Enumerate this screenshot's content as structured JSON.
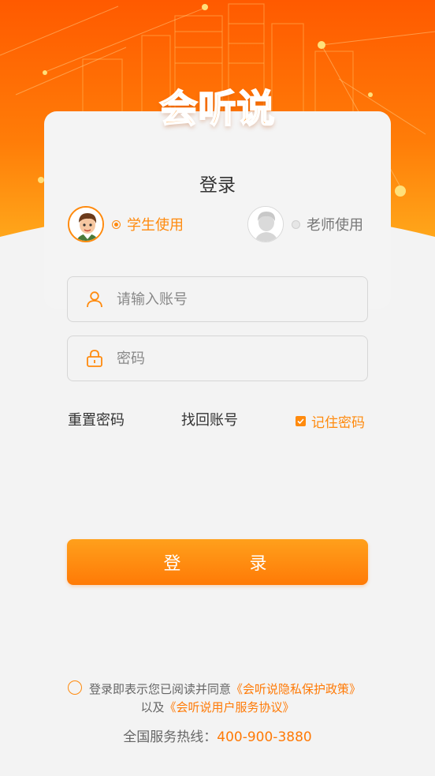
{
  "app": {
    "logo_text": "会听说"
  },
  "colors": {
    "brand": "#ff8a0d",
    "hero_gradient_start": "#ff5a00",
    "hero_gradient_end": "#ffa61a",
    "background": "#f3f3f3",
    "text": "#333333"
  },
  "login": {
    "title": "登录",
    "roles": [
      {
        "label": "学生使用",
        "selected": true,
        "icon": "student-avatar-icon"
      },
      {
        "label": "老师使用",
        "selected": false,
        "icon": "teacher-avatar-icon"
      }
    ],
    "account": {
      "placeholder": "请输入账号",
      "value": "",
      "icon": "user-icon"
    },
    "password": {
      "placeholder": "密码",
      "value": "",
      "icon": "lock-icon"
    },
    "reset_password": "重置密码",
    "recover_account": "找回账号",
    "remember_password": {
      "label": "记住密码",
      "checked": true
    },
    "submit_label": "登 录"
  },
  "footer": {
    "agreement_prefix": "登录即表示您已阅读并同意",
    "privacy_policy": "《会听说隐私保护政策》",
    "agreement_and": "以及",
    "user_agreement": "《会听说用户服务协议》",
    "agreed": false,
    "hotline_label": "全国服务热线：",
    "hotline_number": "400-900-3880"
  }
}
